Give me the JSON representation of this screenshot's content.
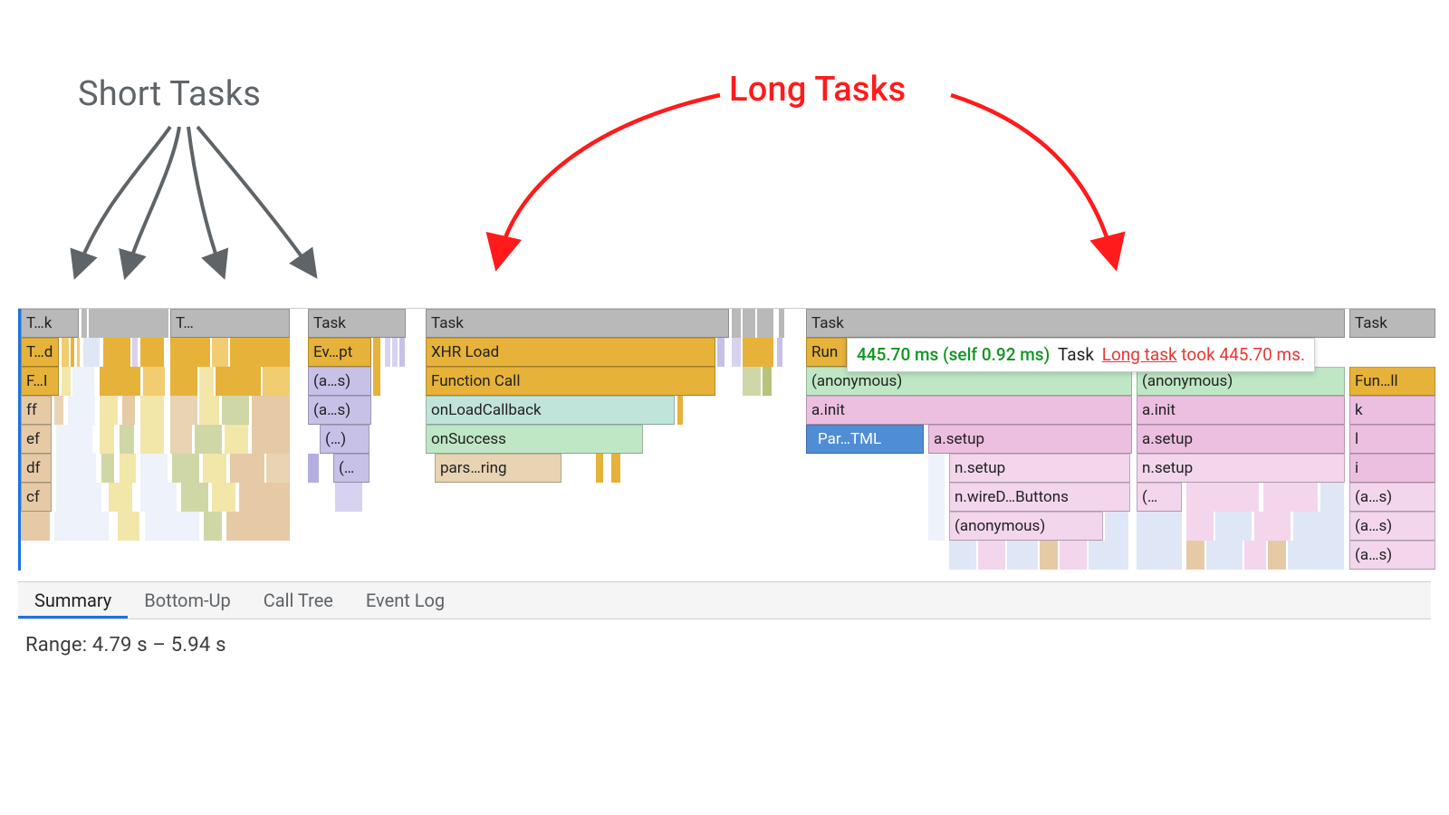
{
  "annotations": {
    "short_tasks": "Short Tasks",
    "long_tasks": "Long Tasks"
  },
  "tooltip": {
    "time": "445.70 ms (self 0.92 ms)",
    "kind": "Task",
    "link": "Long task",
    "suffix": "took 445.70 ms."
  },
  "flame": {
    "row0": {
      "tk": "T…k",
      "t": "T…",
      "task1": "Task",
      "task2": "Task",
      "task3": "Task",
      "task4": "Task"
    },
    "row1": {
      "td": "T…d",
      "evpt": "Ev…pt",
      "xhr": "XHR Load",
      "run": "Run"
    },
    "row2": {
      "fi": "F…I",
      "as1": "(a…s)",
      "fn": "Function Call",
      "anon1": "(anonymous)",
      "anon2": "(anonymous)",
      "funll": "Fun…ll"
    },
    "row3": {
      "ff": "ff",
      "as2": "(a…s)",
      "olc": "onLoadCallback",
      "ainit1": "a.init",
      "ainit2": "a.init",
      "k": "k"
    },
    "row4": {
      "ef": "ef",
      "par": "(…)",
      "osu": "onSuccess",
      "partml": "Par…TML",
      "asetup1": "a.setup",
      "asetup2": "a.setup",
      "l": "l"
    },
    "row5": {
      "df": "df",
      "pstr": "pars…ring",
      "par2": "(…",
      "nsetup1": "n.setup",
      "nsetup2": "n.setup",
      "i": "i"
    },
    "row6": {
      "cf": "cf",
      "wire": "n.wireD…Buttons",
      "par3": "(…",
      "as3": "(a…s)"
    },
    "row7": {
      "anon3": "(anonymous)",
      "as4": "(a…s)"
    },
    "row8": {
      "as5": "(a…s)"
    }
  },
  "tabs": {
    "summary": "Summary",
    "bottom_up": "Bottom-Up",
    "call_tree": "Call Tree",
    "event_log": "Event Log"
  },
  "range": "Range: 4.79 s – 5.94 s"
}
